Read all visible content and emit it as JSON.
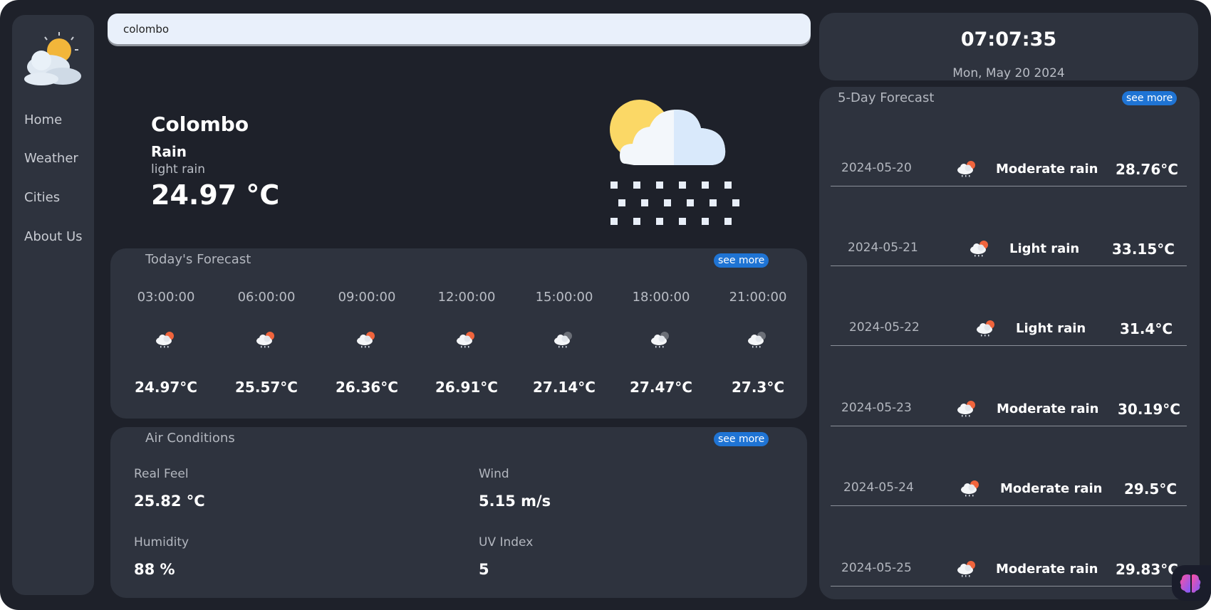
{
  "search": {
    "value": "colombo"
  },
  "sidebar": {
    "items": [
      {
        "label": "Home"
      },
      {
        "label": "Weather"
      },
      {
        "label": "Cities"
      },
      {
        "label": "About Us"
      }
    ]
  },
  "current": {
    "city": "Colombo",
    "condition": "Rain",
    "description": "light rain",
    "temperature": "24.97 °C"
  },
  "today": {
    "title": "Today's Forecast",
    "see_more": "see more",
    "hours": [
      {
        "time": "03:00:00",
        "temp": "24.97°C",
        "icon": "rain-day-icon"
      },
      {
        "time": "06:00:00",
        "temp": "25.57°C",
        "icon": "rain-day-icon"
      },
      {
        "time": "09:00:00",
        "temp": "26.36°C",
        "icon": "rain-day-icon"
      },
      {
        "time": "12:00:00",
        "temp": "26.91°C",
        "icon": "rain-day-icon"
      },
      {
        "time": "15:00:00",
        "temp": "27.14°C",
        "icon": "rain-night-icon"
      },
      {
        "time": "18:00:00",
        "temp": "27.47°C",
        "icon": "rain-night-icon"
      },
      {
        "time": "21:00:00",
        "temp": "27.3°C",
        "icon": "rain-night-icon"
      }
    ]
  },
  "air": {
    "title": "Air Conditions",
    "see_more": "see more",
    "real_feel": {
      "label": "Real Feel",
      "value": "25.82 °C"
    },
    "wind": {
      "label": "Wind",
      "value": "5.15 m/s"
    },
    "humidity": {
      "label": "Humidity",
      "value": "88 %"
    },
    "uv": {
      "label": "UV Index",
      "value": "5"
    }
  },
  "clock": {
    "time": "07:07:35",
    "date": "Mon, May 20 2024"
  },
  "five_day": {
    "title": "5-Day Forecast",
    "see_more": "see more",
    "days": [
      {
        "date": "2024-05-20",
        "desc": "Moderate rain",
        "temp": "28.76°C"
      },
      {
        "date": "2024-05-21",
        "desc": "Light rain",
        "temp": "33.15°C"
      },
      {
        "date": "2024-05-22",
        "desc": "Light rain",
        "temp": "31.4°C"
      },
      {
        "date": "2024-05-23",
        "desc": "Moderate rain",
        "temp": "30.19°C"
      },
      {
        "date": "2024-05-24",
        "desc": "Moderate rain",
        "temp": "29.5°C"
      },
      {
        "date": "2024-05-25",
        "desc": "Moderate rain",
        "temp": "29.83°C"
      }
    ]
  },
  "colors": {
    "background": "#1e212a",
    "panel": "#2e333e",
    "accent": "#1f74d4",
    "search_bg": "#e9f0fb"
  }
}
